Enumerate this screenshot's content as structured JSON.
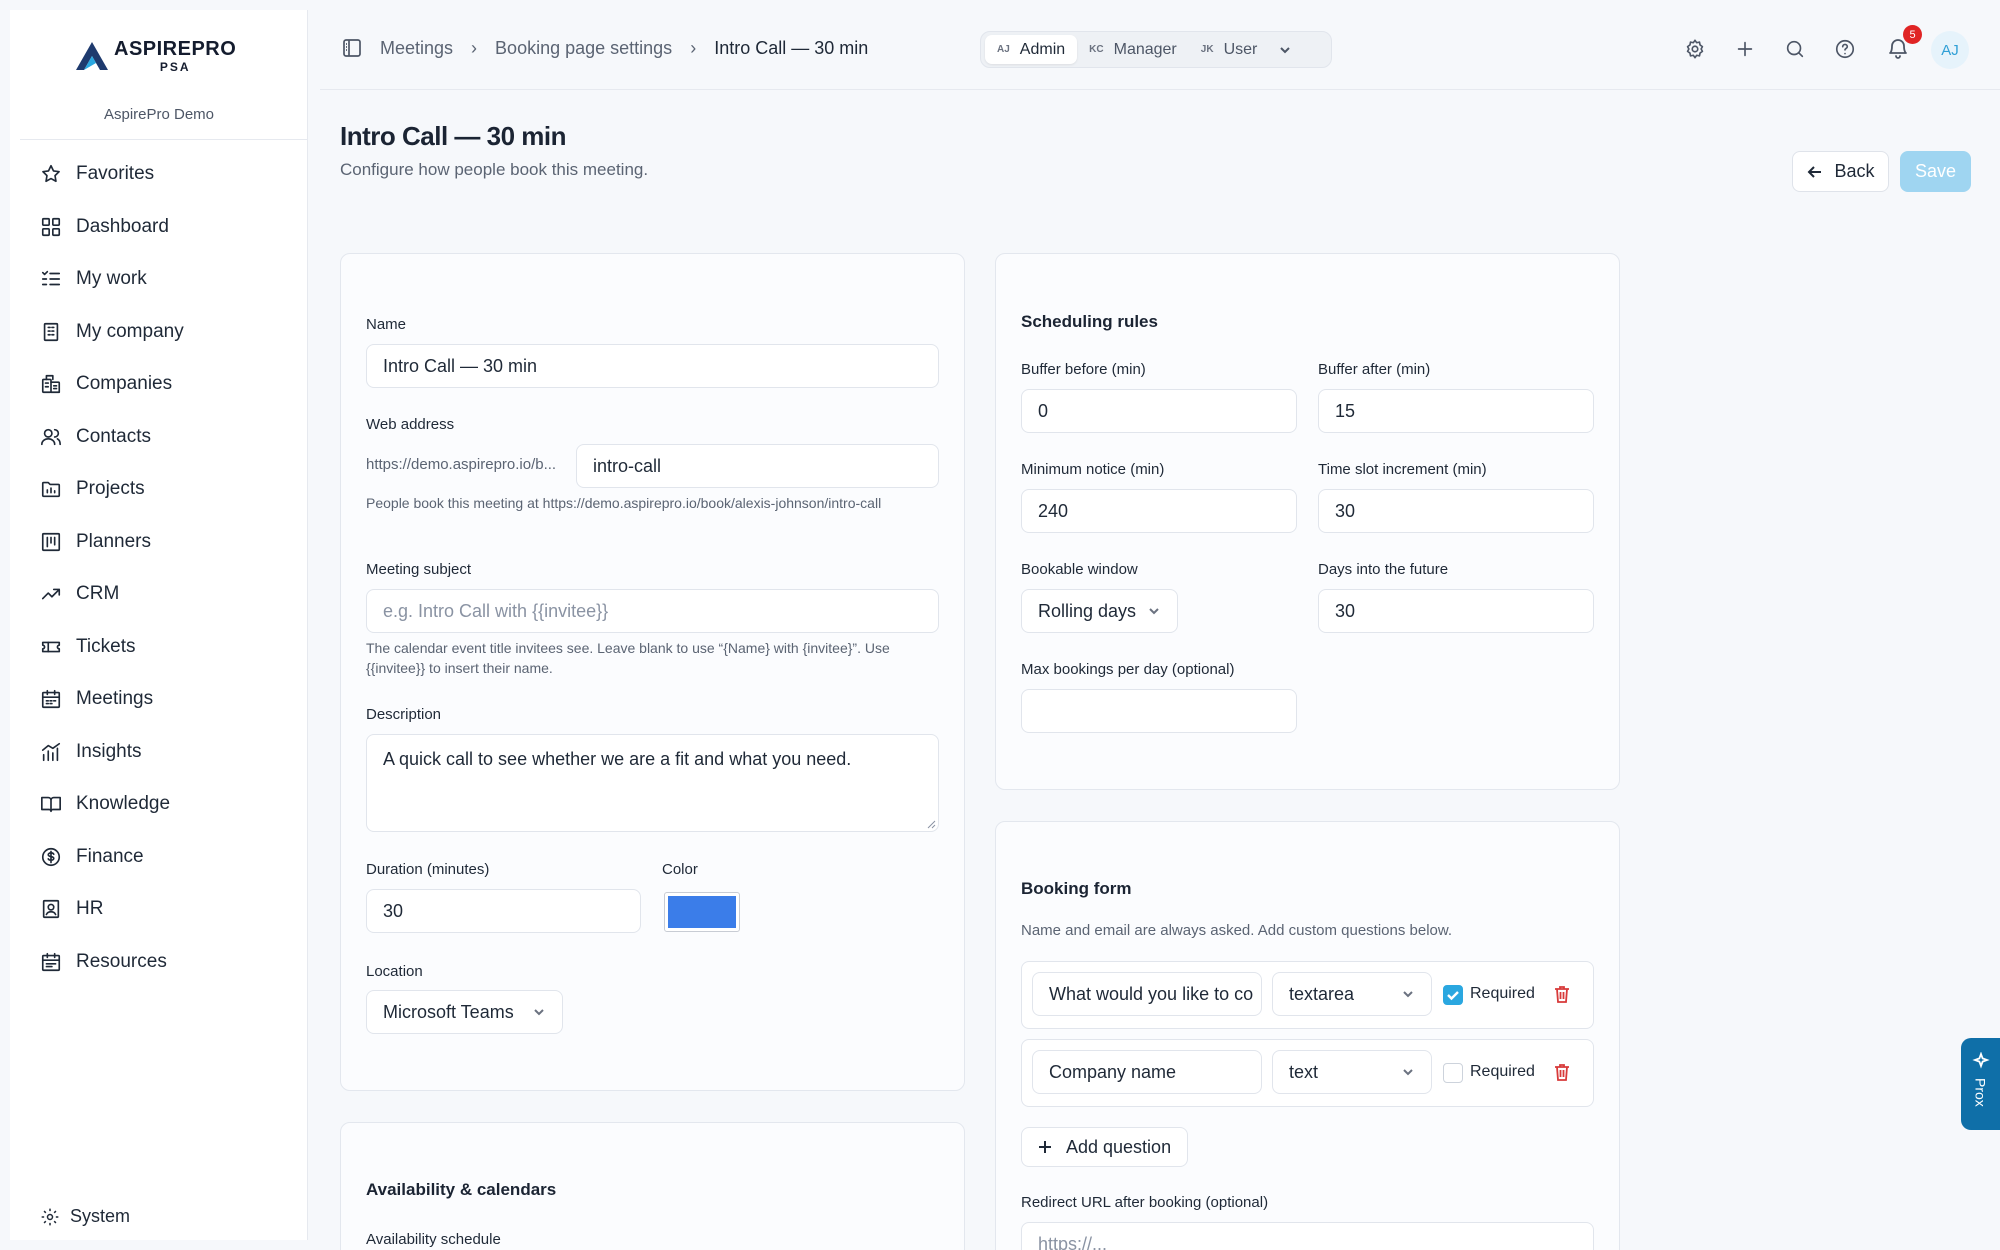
{
  "app": {
    "logo_line1": "ASPIREPRO",
    "logo_line2": "PSA",
    "org_name": "AspirePro Demo"
  },
  "sidebar": {
    "items": [
      {
        "label": "Favorites",
        "icon": "star-icon"
      },
      {
        "label": "Dashboard",
        "icon": "grid-icon"
      },
      {
        "label": "My work",
        "icon": "list-check-icon"
      },
      {
        "label": "My company",
        "icon": "building-icon"
      },
      {
        "label": "Companies",
        "icon": "buildings-icon"
      },
      {
        "label": "Contacts",
        "icon": "users-icon"
      },
      {
        "label": "Projects",
        "icon": "folder-icon"
      },
      {
        "label": "Planners",
        "icon": "kanban-icon"
      },
      {
        "label": "CRM",
        "icon": "trend-icon"
      },
      {
        "label": "Tickets",
        "icon": "ticket-icon"
      },
      {
        "label": "Meetings",
        "icon": "calendar-icon"
      },
      {
        "label": "Insights",
        "icon": "chart-icon"
      },
      {
        "label": "Knowledge",
        "icon": "book-icon"
      },
      {
        "label": "Finance",
        "icon": "dollar-icon"
      },
      {
        "label": "HR",
        "icon": "id-badge-icon"
      },
      {
        "label": "Resources",
        "icon": "calendar-grid-icon"
      }
    ],
    "system_label": "System"
  },
  "topbar": {
    "breadcrumbs": [
      "Meetings",
      "Booking page settings",
      "Intro Call — 30 min"
    ],
    "roles": [
      {
        "initials": "AJ",
        "label": "Admin",
        "active": true
      },
      {
        "initials": "KC",
        "label": "Manager",
        "active": false
      },
      {
        "initials": "JK",
        "label": "User",
        "active": false
      }
    ],
    "notification_count": "5",
    "avatar_initials": "AJ"
  },
  "header": {
    "title": "Intro Call — 30 min",
    "subtitle": "Configure how people book this meeting.",
    "back_label": "Back",
    "save_label": "Save"
  },
  "general": {
    "name_label": "Name",
    "name_value": "Intro Call — 30 min",
    "web_label": "Web address",
    "web_prefix": "https://demo.aspirepro.io/b...",
    "web_slug": "intro-call",
    "web_help": "People book this meeting at https://demo.aspirepro.io/book/alexis-johnson/intro-call",
    "subject_label": "Meeting subject",
    "subject_placeholder": "e.g. Intro Call with {{invitee}}",
    "subject_help": "The calendar event title invitees see. Leave blank to use “{Name} with {invitee}”. Use {{invitee}} to insert their name.",
    "description_label": "Description",
    "description_value": "A quick call to see whether we are a fit and what you need.",
    "duration_label": "Duration (minutes)",
    "duration_value": "30",
    "color_label": "Color",
    "color_value": "#3b7de9",
    "location_label": "Location",
    "location_value": "Microsoft Teams"
  },
  "availability": {
    "title": "Availability & calendars",
    "schedule_label": "Availability schedule"
  },
  "scheduling": {
    "title": "Scheduling rules",
    "buffer_before_label": "Buffer before (min)",
    "buffer_before_value": "0",
    "buffer_after_label": "Buffer after (min)",
    "buffer_after_value": "15",
    "min_notice_label": "Minimum notice (min)",
    "min_notice_value": "240",
    "increment_label": "Time slot increment (min)",
    "increment_value": "30",
    "window_label": "Bookable window",
    "window_value": "Rolling days",
    "days_label": "Days into the future",
    "days_value": "30",
    "max_label": "Max bookings per day (optional)",
    "max_value": ""
  },
  "booking_form": {
    "title": "Booking form",
    "help": "Name and email are always asked. Add custom questions below.",
    "questions": [
      {
        "text": "What would you like to co",
        "type": "textarea",
        "required": true
      },
      {
        "text": "Company name",
        "type": "text",
        "required": false
      }
    ],
    "required_label": "Required",
    "add_label": "Add question",
    "redirect_label": "Redirect URL after booking (optional)",
    "redirect_placeholder": "https://..."
  },
  "assistant": {
    "label": "Prox"
  }
}
